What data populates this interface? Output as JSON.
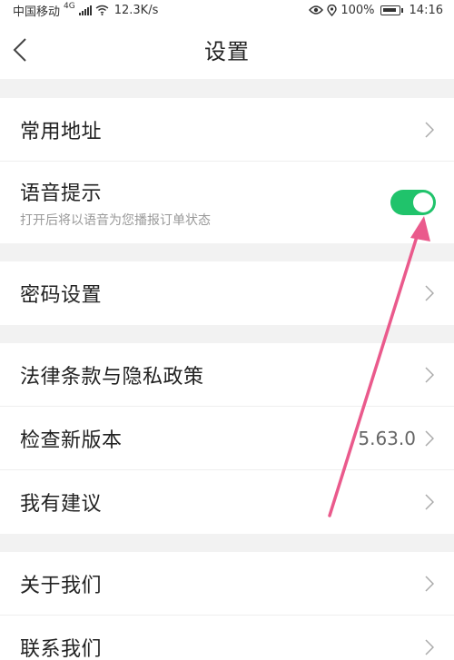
{
  "status_bar": {
    "carrier": "中国移动",
    "network": "4G",
    "speed": "12.3K/s",
    "battery": "100%",
    "time": "14:16"
  },
  "header": {
    "title": "设置"
  },
  "items": {
    "address": {
      "label": "常用地址"
    },
    "voice": {
      "label": "语音提示",
      "subtitle": "打开后将以语音为您播报订单状态",
      "enabled": true
    },
    "password": {
      "label": "密码设置"
    },
    "legal": {
      "label": "法律条款与隐私政策"
    },
    "version": {
      "label": "检查新版本",
      "value": "5.63.0"
    },
    "feedback": {
      "label": "我有建议"
    },
    "about": {
      "label": "关于我们"
    },
    "contact": {
      "label": "联系我们"
    }
  },
  "colors": {
    "toggle_on": "#20c36b",
    "annotation_arrow": "#ea5a8c",
    "section_gap": "#f2f2f2"
  },
  "icons": [
    "back-arrow-icon",
    "chevron-right-icon",
    "eye-icon",
    "location-icon",
    "wifi-icon",
    "signal-icon",
    "battery-icon"
  ]
}
